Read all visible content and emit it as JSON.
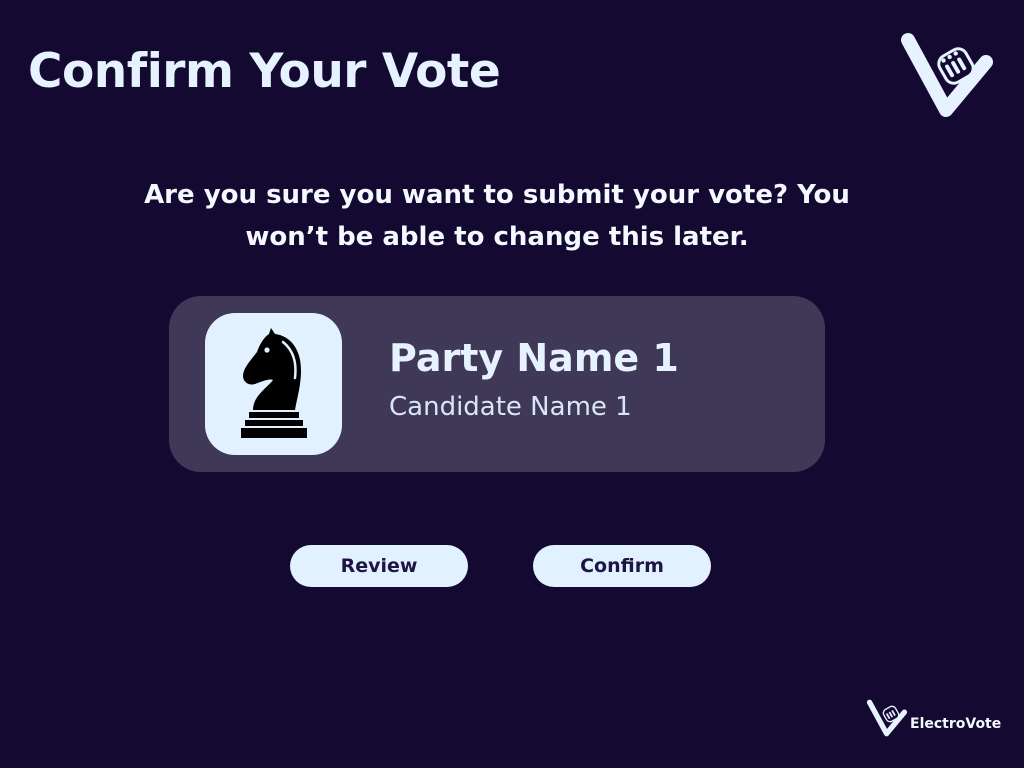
{
  "header": {
    "title": "Confirm Your Vote",
    "logo_icon": "electrovote-v-logo-icon"
  },
  "prompt": {
    "text": "Are you sure you want to submit your vote? You won’t be able to change this later."
  },
  "selection": {
    "party_icon": "chess-knight-icon",
    "party_name": "Party Name 1",
    "candidate_name": "Candidate Name 1"
  },
  "actions": {
    "review_label": "Review",
    "confirm_label": "Confirm"
  },
  "footer": {
    "brand_icon": "electrovote-v-logo-icon",
    "brand_name": "ElectroVote"
  },
  "colors": {
    "background": "#140a31",
    "card": "#3f3857",
    "accent_light": "#e2f1ff",
    "button_text": "#1c1640"
  }
}
